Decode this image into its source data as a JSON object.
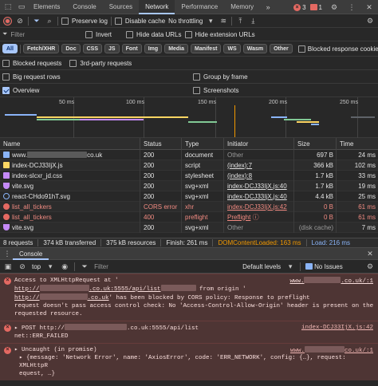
{
  "tabs": [
    "Elements",
    "Console",
    "Sources",
    "Network",
    "Performance",
    "Memory"
  ],
  "active_tab": "Network",
  "error_count": "3",
  "warning_count": "1",
  "toolbar": {
    "preserve_log": "Preserve log",
    "disable_cache": "Disable cache",
    "throttling": "No throttling"
  },
  "filter": {
    "placeholder": "Filter",
    "invert": "Invert",
    "hide_data_urls": "Hide data URLs",
    "hide_ext_urls": "Hide extension URLs"
  },
  "type_chips": [
    "All",
    "Fetch/XHR",
    "Doc",
    "CSS",
    "JS",
    "Font",
    "Img",
    "Media",
    "Manifest",
    "WS",
    "Wasm",
    "Other"
  ],
  "blocked_cookies": "Blocked response cookies",
  "blocked_requests": "Blocked requests",
  "third_party": "3rd-party requests",
  "big_rows": "Big request rows",
  "group_by_frame": "Group by frame",
  "overview": "Overview",
  "screenshots": "Screenshots",
  "timeline_ticks": [
    "50 ms",
    "100 ms",
    "150 ms",
    "200 ms",
    "250 ms"
  ],
  "columns": [
    "Name",
    "Status",
    "Type",
    "Initiator",
    "Size",
    "Time"
  ],
  "requests": [
    {
      "name_prefix": "www.",
      "name_suffix": "co.uk",
      "status": "200",
      "type": "document",
      "initiator": "Other",
      "size": "697 B",
      "time": "24 ms",
      "icon": "doc",
      "error": false
    },
    {
      "name": "index-DCJ33IjX.js",
      "status": "200",
      "type": "script",
      "initiator": "(index):7",
      "size": "366 kB",
      "time": "102 ms",
      "icon": "js",
      "error": false
    },
    {
      "name": "index-slcxr_jd.css",
      "status": "200",
      "type": "stylesheet",
      "initiator": "(index):8",
      "size": "1.7 kB",
      "time": "33 ms",
      "icon": "css",
      "error": false
    },
    {
      "name": "vite.svg",
      "status": "200",
      "type": "svg+xml",
      "initiator": "index-DCJ33IjX.js:40",
      "size": "1.7 kB",
      "time": "19 ms",
      "icon": "img",
      "error": false
    },
    {
      "name": "react-CHdo91hT.svg",
      "status": "200",
      "type": "svg+xml",
      "initiator": "index-DCJ33IjX.js:40",
      "size": "4.4 kB",
      "time": "25 ms",
      "icon": "react",
      "error": false
    },
    {
      "name": "list_all_tickers",
      "status": "CORS error",
      "type": "xhr",
      "initiator": "index-DCJ33IjX.js:42",
      "size": "0 B",
      "time": "61 ms",
      "icon": "err",
      "error": true
    },
    {
      "name": "list_all_tickers",
      "status": "400",
      "type": "preflight",
      "initiator": "Preflight",
      "size": "0 B",
      "time": "61 ms",
      "icon": "err",
      "error": true
    },
    {
      "name": "vite.svg",
      "status": "200",
      "type": "svg+xml",
      "initiator": "Other",
      "size": "(disk cache)",
      "time": "7 ms",
      "icon": "img",
      "error": false
    }
  ],
  "status": {
    "requests": "8 requests",
    "transferred": "374 kB transferred",
    "resources": "375 kB resources",
    "finish": "Finish: 261 ms",
    "dcl": "DOMContentLoaded: 163 ms",
    "load": "Load: 216 ms"
  },
  "console": {
    "tab": "Console",
    "context": "top",
    "filter_placeholder": "Filter",
    "levels": "Default levels",
    "issues": "No Issues",
    "messages": [
      {
        "line1_a": "Access to XMLHttpRequest at '",
        "line1_b": ".co.uk:5555/api/list",
        "line1_c": "from origin '",
        "line1_www": "www.",
        "line1_tail": ".co.uk/:1",
        "line2_a": "http://",
        "line2_b": ".co.uk",
        "line2_c": "' has been blocked by CORS policy: Response to preflight",
        "line3": "request doesn't pass access control check: No 'Access-Control-Allow-Origin' header is present on the",
        "line4": "requested resource."
      },
      {
        "prefix": "▸ POST http://",
        "mid": ".co.uk:5555/api/list",
        "src": "index-DCJ33IjX.js:42",
        "line2": "net::ERR_FAILED"
      },
      {
        "line1": "▸ Uncaught (in promise)",
        "src_www": "www.",
        "src_tail": "co.uk/:1",
        "line2": "▸ {message: 'Network Error', name: 'AxiosError', code: 'ERR_NETWORK', config: {…}, request: XMLHttpR",
        "line3": "equest, …}"
      }
    ]
  },
  "colors": {
    "accent": "#a8c7fa",
    "error": "#f28b82",
    "dcl": "#82aaff",
    "load": "#f28b82"
  }
}
